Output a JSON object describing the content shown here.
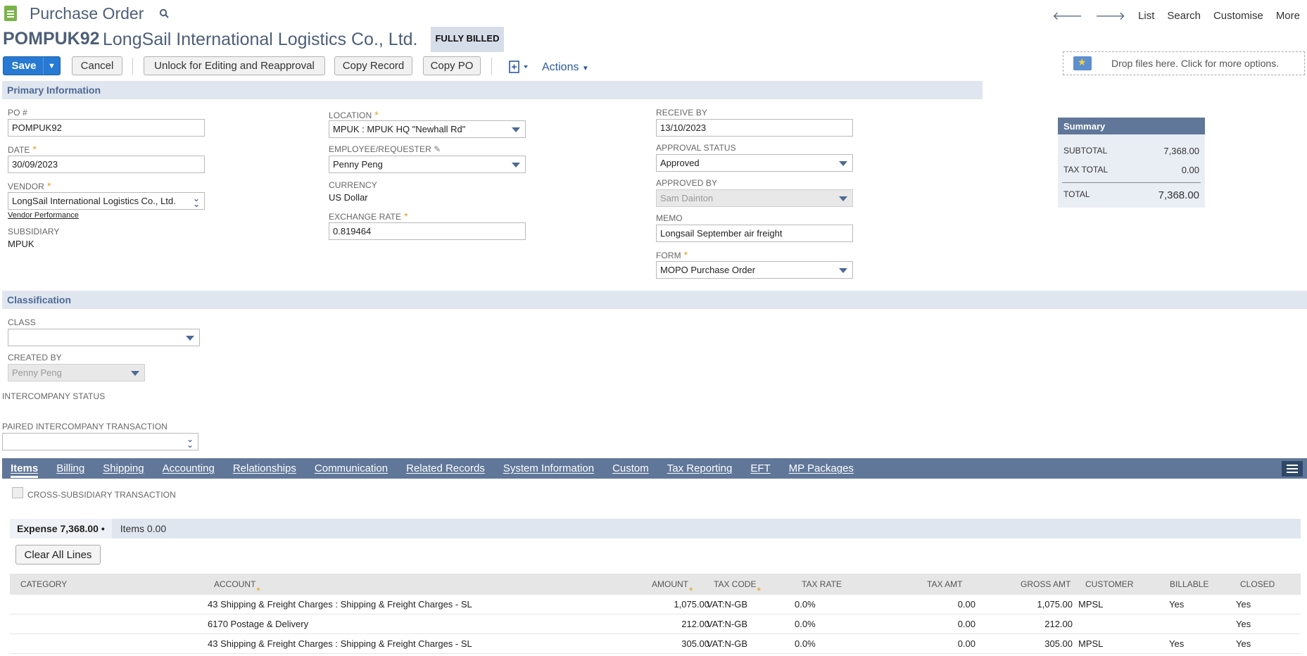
{
  "header": {
    "page_title": "Purchase Order",
    "record_id": "POMPUK92",
    "record_name": "LongSail International Logistics Co., Ltd.",
    "status": "FULLY BILLED",
    "nav": {
      "list": "List",
      "search": "Search",
      "customise": "Customise",
      "more": "More"
    }
  },
  "toolbar": {
    "save": "Save",
    "cancel": "Cancel",
    "unlock": "Unlock for Editing and Reapproval",
    "copy_record": "Copy Record",
    "copy_po": "Copy PO",
    "actions": "Actions"
  },
  "drop_zone": {
    "text": "Drop files here. Click for more options."
  },
  "primary": {
    "section_title": "Primary Information",
    "po_label": "PO #",
    "po_value": "POMPUK92",
    "date_label": "DATE",
    "date_value": "30/09/2023",
    "vendor_label": "VENDOR",
    "vendor_value": "LongSail International Logistics Co., Ltd.",
    "vendor_perf": "Vendor Performance",
    "subsidiary_label": "SUBSIDIARY",
    "subsidiary_value": "MPUK",
    "location_label": "LOCATION",
    "location_value": "MPUK : MPUK HQ \"Newhall Rd\"",
    "employee_label": "EMPLOYEE/REQUESTER",
    "employee_value": "Penny Peng",
    "currency_label": "CURRENCY",
    "currency_value": "US Dollar",
    "exchange_label": "EXCHANGE RATE",
    "exchange_value": "0.819464",
    "receive_label": "RECEIVE BY",
    "receive_value": "13/10/2023",
    "approval_label": "APPROVAL STATUS",
    "approval_value": "Approved",
    "approved_by_label": "APPROVED BY",
    "approved_by_value": "Sam Dainton",
    "memo_label": "MEMO",
    "memo_value": "Longsail September air freight",
    "form_label": "FORM",
    "form_value": "MOPO Purchase Order"
  },
  "summary": {
    "title": "Summary",
    "subtotal_label": "SUBTOTAL",
    "subtotal_value": "7,368.00",
    "tax_label": "TAX TOTAL",
    "tax_value": "0.00",
    "total_label": "TOTAL",
    "total_value": "7,368.00"
  },
  "classification": {
    "section_title": "Classification",
    "class_label": "CLASS",
    "class_value": "",
    "created_by_label": "CREATED BY",
    "created_by_value": "Penny Peng",
    "interco_status_label": "INTERCOMPANY STATUS",
    "paired_label": "PAIRED INTERCOMPANY TRANSACTION",
    "paired_value": ""
  },
  "tabs": [
    "Items",
    "Billing",
    "Shipping",
    "Accounting",
    "Relationships",
    "Communication",
    "Related Records",
    "System Information",
    "Custom",
    "Tax Reporting",
    "EFT",
    "MP Packages"
  ],
  "items": {
    "cross_sub_label": "CROSS-SUBSIDIARY TRANSACTION",
    "expense_tab": "Expense 7,368.00 •",
    "items_tab": "Items 0.00",
    "clear_all": "Clear All Lines",
    "columns": {
      "category": "CATEGORY",
      "account": "ACCOUNT",
      "amount": "AMOUNT",
      "tax_code": "TAX CODE",
      "tax_rate": "TAX RATE",
      "tax_amt": "TAX AMT",
      "gross_amt": "GROSS AMT",
      "customer": "CUSTOMER",
      "billable": "BILLABLE",
      "closed": "CLOSED"
    },
    "rows": [
      {
        "category": "",
        "account": "43 Shipping & Freight Charges : Shipping & Freight Charges - SL",
        "amount": "1,075.00",
        "tax_code": "VAT:N-GB",
        "tax_rate": "0.0%",
        "tax_amt": "0.00",
        "gross_amt": "1,075.00",
        "customer": "MPSL",
        "billable": "Yes",
        "closed": "Yes"
      },
      {
        "category": "",
        "account": "6170 Postage & Delivery",
        "amount": "212.00",
        "tax_code": "VAT:N-GB",
        "tax_rate": "0.0%",
        "tax_amt": "0.00",
        "gross_amt": "212.00",
        "customer": "",
        "billable": "",
        "closed": "Yes"
      },
      {
        "category": "",
        "account": "43 Shipping & Freight Charges : Shipping & Freight Charges - SL",
        "amount": "305.00",
        "tax_code": "VAT:N-GB",
        "tax_rate": "0.0%",
        "tax_amt": "0.00",
        "gross_amt": "305.00",
        "customer": "MPSL",
        "billable": "Yes",
        "closed": "Yes"
      }
    ]
  },
  "colors": {
    "accent": "#607799",
    "save": "#2779d3",
    "required": "#e3a01c"
  }
}
